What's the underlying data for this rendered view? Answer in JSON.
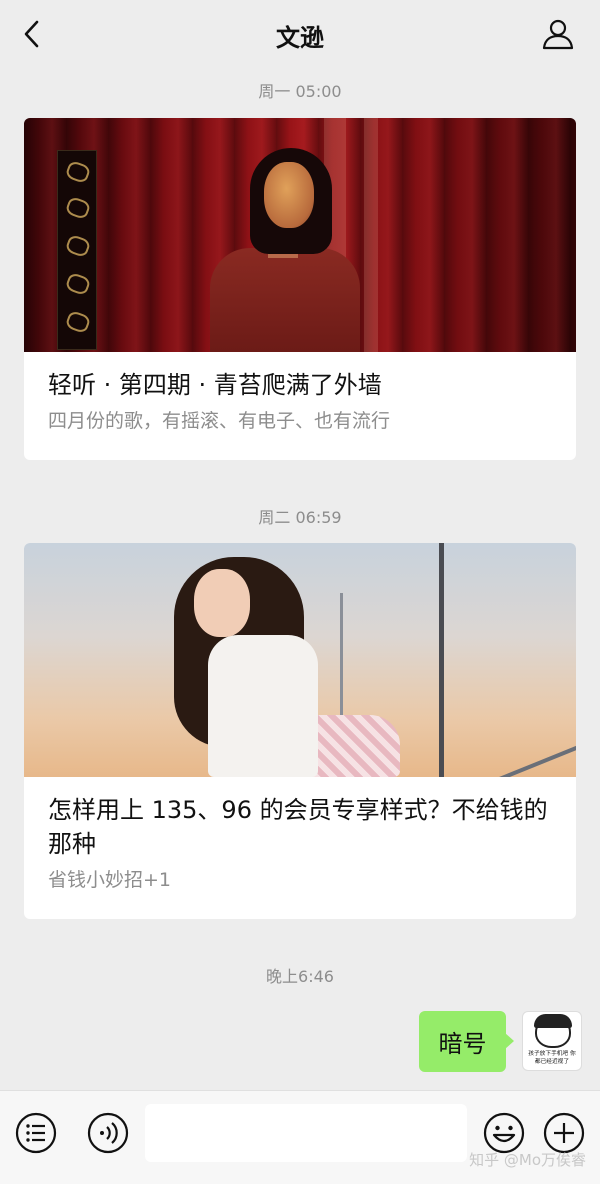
{
  "header": {
    "title": "文逊"
  },
  "feed": [
    {
      "time": "周一 05:00",
      "title": "轻听 · 第四期 · 青苔爬满了外墙",
      "subtitle": "四月份的歌，有摇滚、有电子、也有流行"
    },
    {
      "time": "周二 06:59",
      "title": "怎样用上 135、96 的会员专享样式？不给钱的那种",
      "subtitle": "省钱小妙招+1"
    }
  ],
  "chat": {
    "time": "晚上6:46",
    "message": "暗号",
    "avatar_caption": "孩子放下手机吧 你都已经近视了"
  },
  "toolbar": {
    "input_value": "",
    "watermark": "知乎 @Mo万俟睿"
  },
  "icons": {
    "back": "chevron-left-icon",
    "profile": "user-icon",
    "menu": "list-icon",
    "voice": "voice-icon",
    "emoji": "smile-icon",
    "more": "plus-icon"
  }
}
